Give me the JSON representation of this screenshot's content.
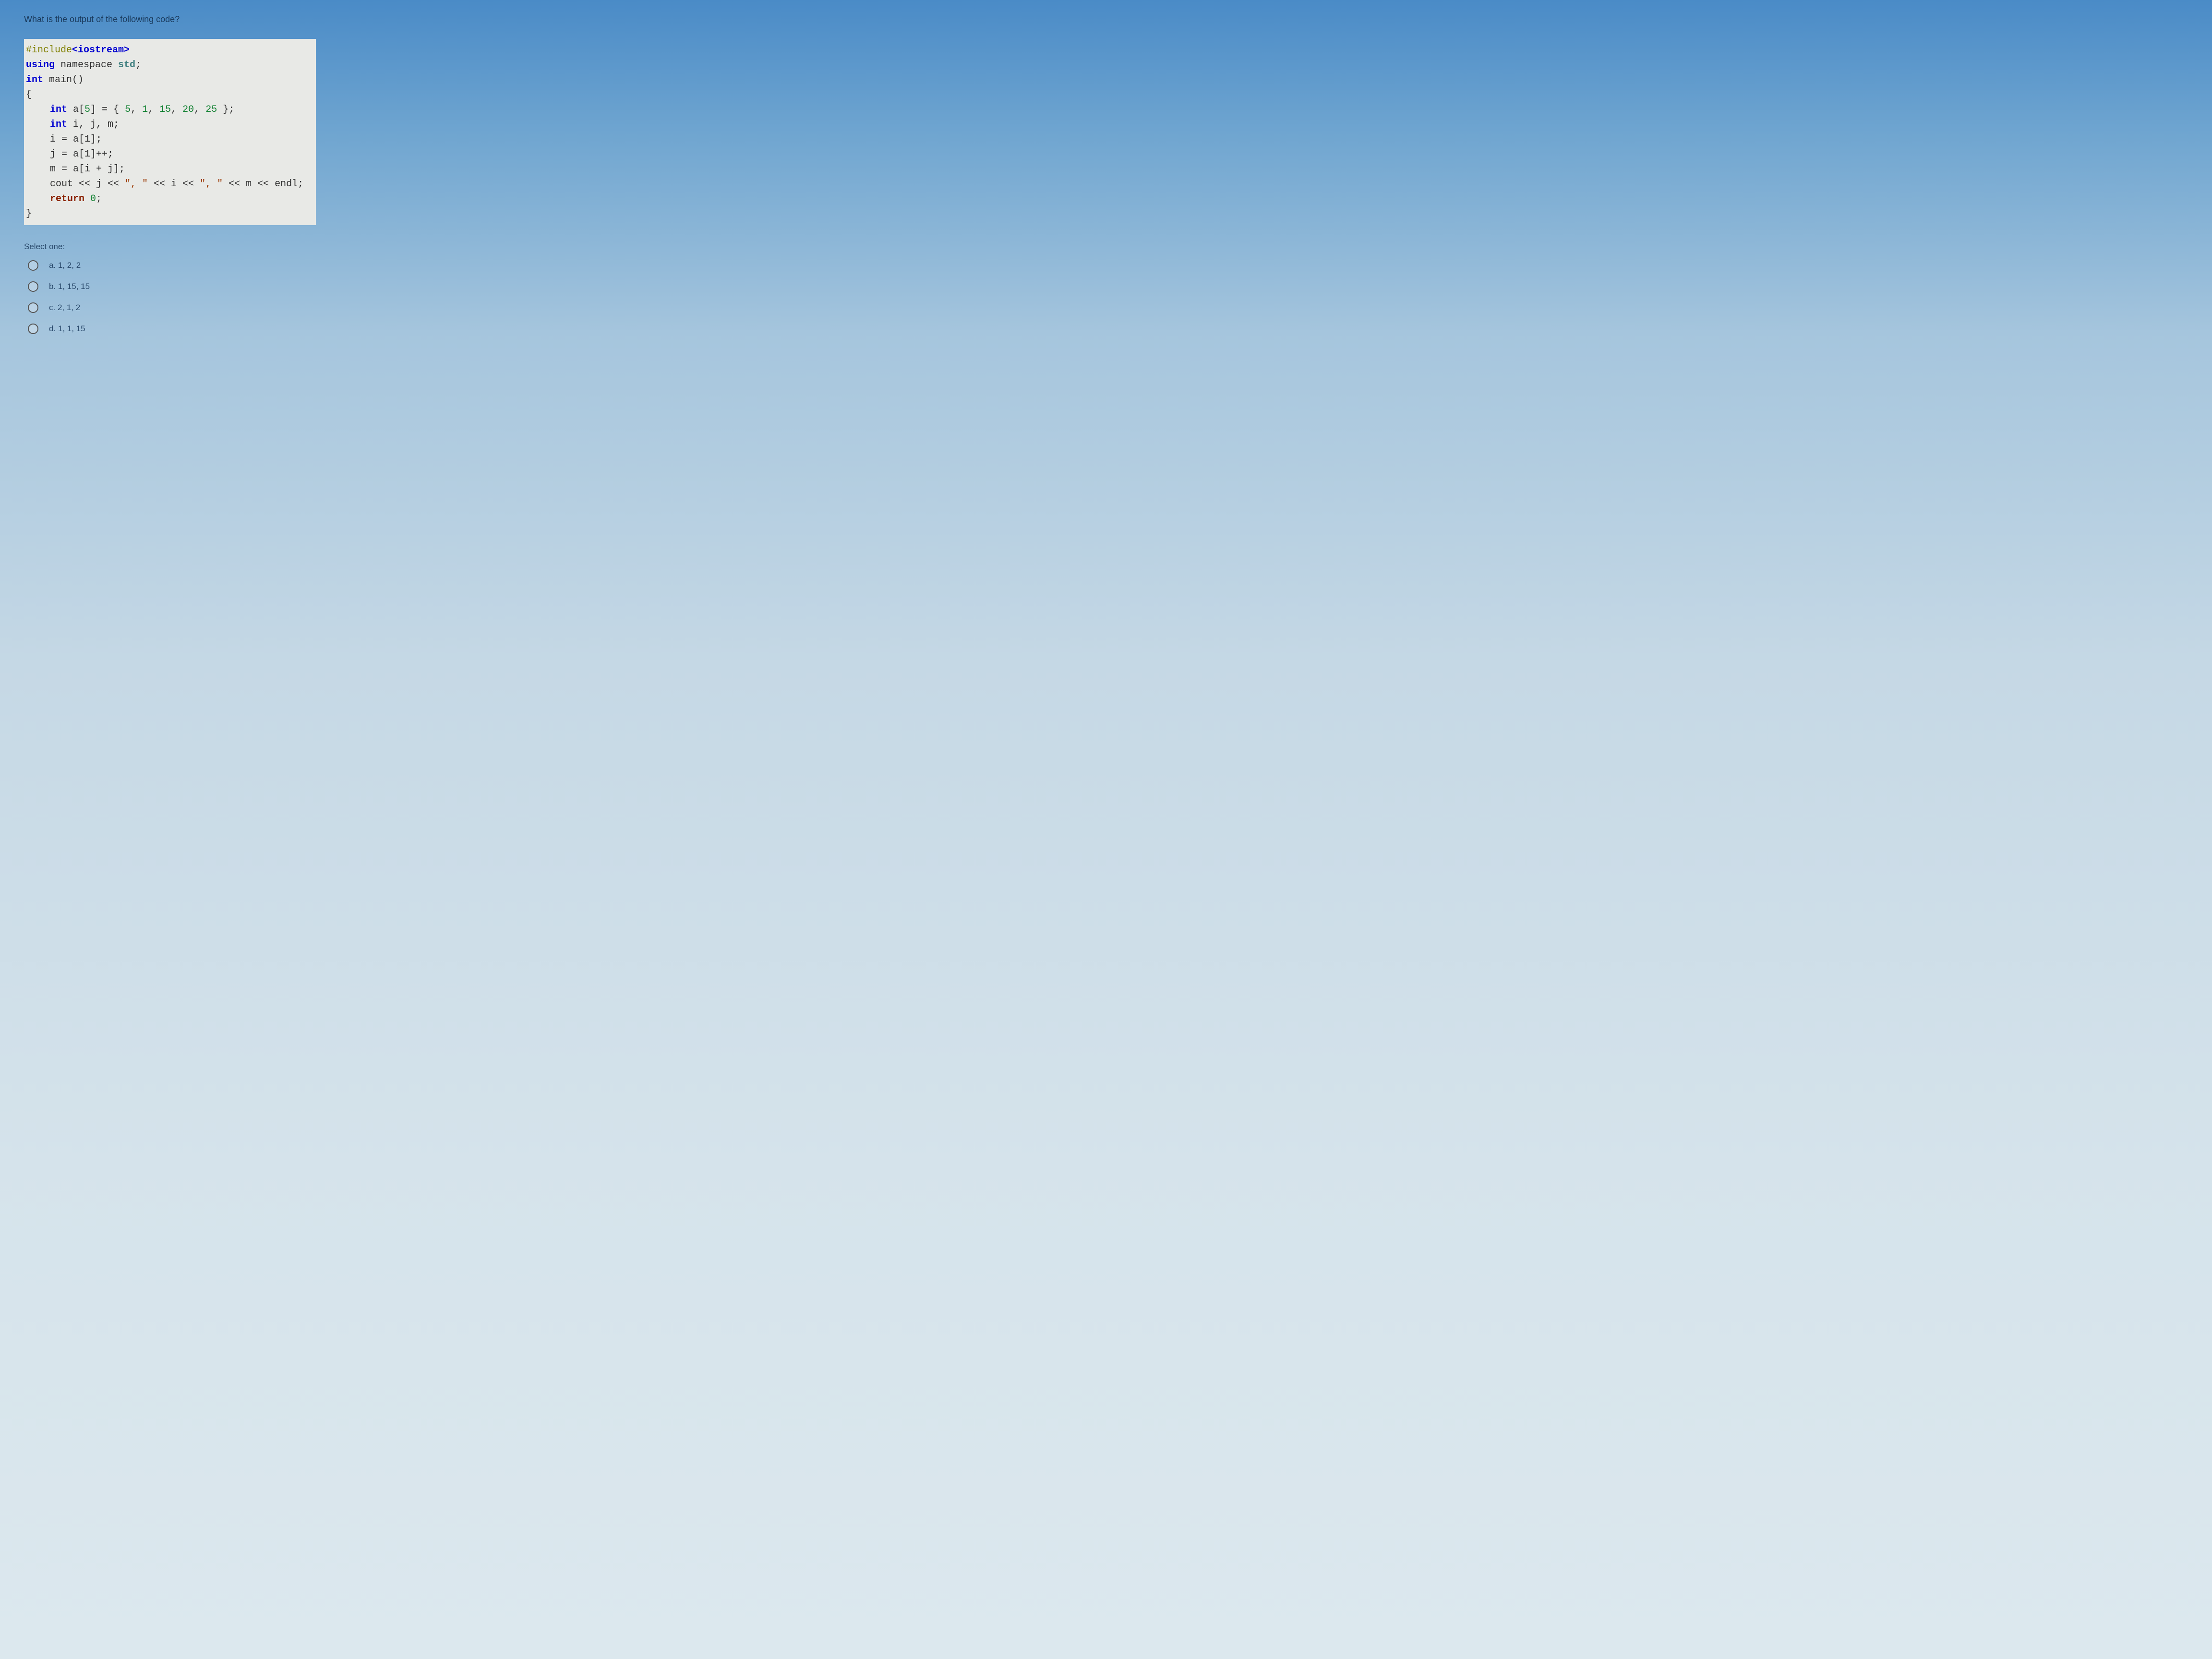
{
  "question": "What is the output of the following code?",
  "code": {
    "l1a": "#include",
    "l1b": "<iostream>",
    "l2a": "using",
    "l2b": " namespace ",
    "l2c": "std",
    "l2d": ";",
    "l3a": "int",
    "l3b": " main()",
    "l4": "{",
    "l5a": "int",
    "l5b": " a[",
    "l5c": "5",
    "l5d": "] = { ",
    "l5e": "5",
    "l5f": ", ",
    "l5g": "1",
    "l5h": ", ",
    "l5i": "15",
    "l5j": ", ",
    "l5k": "20",
    "l5l": ", ",
    "l5m": "25",
    "l5n": " };",
    "l6a": "int",
    "l6b": " i, j, m;",
    "l7": "i = a[1];",
    "l8": "j = a[1]++;",
    "l9": "m = a[i + j];",
    "l10a": "cout << j << ",
    "l10b": "\", \"",
    "l10c": " << i << ",
    "l10d": "\", \"",
    "l10e": " << m << endl;",
    "l11a": "return",
    "l11b": " ",
    "l11c": "0",
    "l11d": ";",
    "l12": "}"
  },
  "select_label": "Select one:",
  "options": [
    {
      "label": "a. 1, 2, 2"
    },
    {
      "label": "b. 1, 15, 15"
    },
    {
      "label": "c. 2, 1, 2"
    },
    {
      "label": "d. 1, 1, 15"
    }
  ]
}
